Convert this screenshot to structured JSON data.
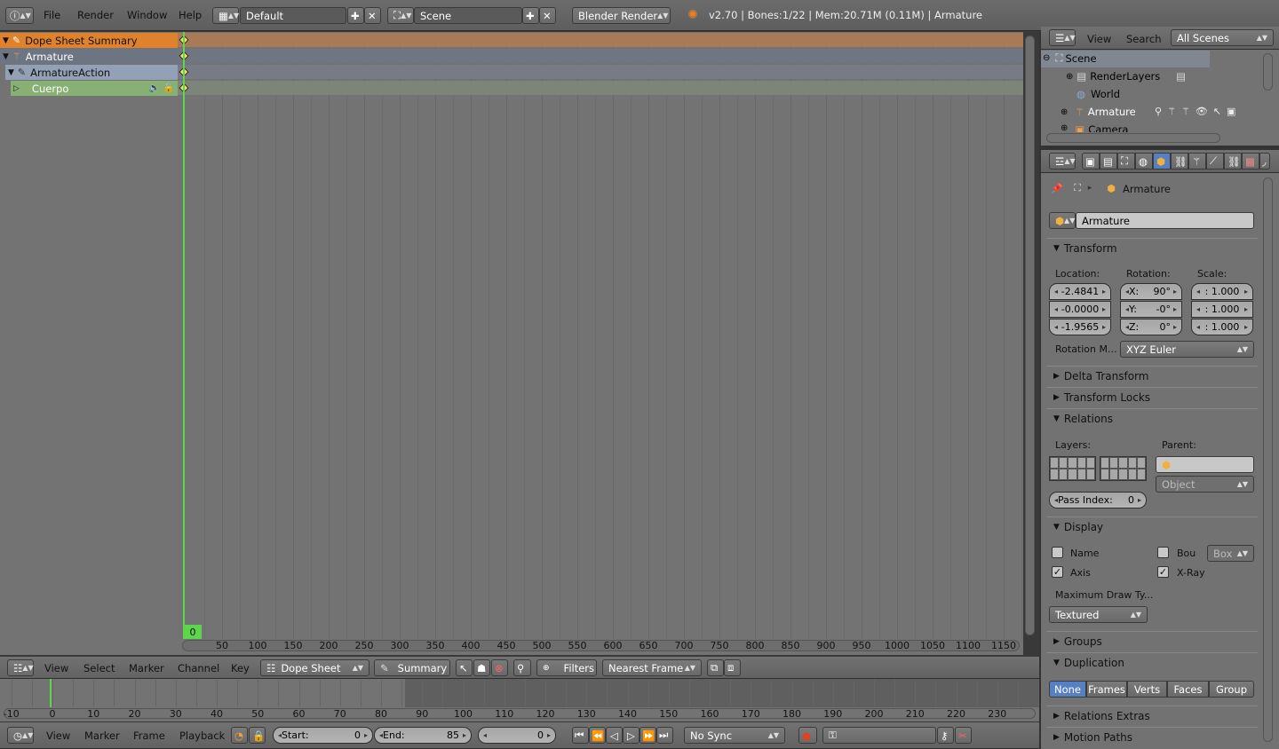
{
  "topbar": {
    "menus": [
      "File",
      "Render",
      "Window",
      "Help"
    ],
    "layout": "Default",
    "scene": "Scene",
    "engine": "Blender Render",
    "status": "v2.70 | Bones:1/22 | Mem:20.71M (0.11M) | Armature"
  },
  "dopesheet": {
    "channels": [
      {
        "label": "Dope Sheet Summary"
      },
      {
        "label": "Armature"
      },
      {
        "label": "ArmatureAction"
      },
      {
        "label": "Cuerpo"
      }
    ],
    "current_frame": "0",
    "ruler": [
      "50",
      "100",
      "150",
      "200",
      "250",
      "300",
      "350",
      "400",
      "450",
      "500",
      "550",
      "600",
      "650",
      "700",
      "750",
      "800",
      "850",
      "900",
      "950",
      "1000",
      "1050",
      "1100",
      "1150"
    ],
    "header": {
      "menus": [
        "View",
        "Select",
        "Marker",
        "Channel",
        "Key"
      ],
      "mode": "Dope Sheet",
      "summary": "Summary",
      "filters": "Filters",
      "snap": "Nearest Frame"
    }
  },
  "timeline": {
    "ruler": [
      "-10",
      "0",
      "10",
      "20",
      "30",
      "40",
      "50",
      "60",
      "70",
      "80",
      "90",
      "100",
      "110",
      "120",
      "130",
      "140",
      "150",
      "160",
      "170",
      "180",
      "190",
      "200",
      "210",
      "220",
      "230"
    ],
    "header": {
      "menus": [
        "View",
        "Marker",
        "Frame",
        "Playback"
      ],
      "start_label": "Start:",
      "start": "0",
      "end_label": "End:",
      "end": "85",
      "frame": "0",
      "sync": "No Sync"
    }
  },
  "outliner": {
    "menus": [
      "View",
      "Search"
    ],
    "filter": "All Scenes",
    "items": [
      {
        "label": "Scene"
      },
      {
        "label": "RenderLayers"
      },
      {
        "label": "World"
      },
      {
        "label": "Armature"
      },
      {
        "label": "Camera"
      }
    ]
  },
  "properties": {
    "breadcrumb": "Armature",
    "object_name": "Armature",
    "transform": {
      "title": "Transform",
      "location_label": "Location:",
      "rotation_label": "Rotation:",
      "scale_label": "Scale:",
      "location": [
        "-2.4841",
        "-0.0000",
        "-1.9565"
      ],
      "rotation_axes": [
        "X:",
        "Y:",
        "Z:"
      ],
      "rotation": [
        "90°",
        "-0°",
        "0°"
      ],
      "scale": [
        ": 1.000",
        ": 1.000",
        ": 1.000"
      ],
      "rotation_mode_label": "Rotation M...",
      "rotation_mode": "XYZ Euler"
    },
    "delta_transform": "Delta Transform",
    "transform_locks": "Transform Locks",
    "relations": {
      "title": "Relations",
      "layers_label": "Layers:",
      "parent_label": "Parent:",
      "parent_type": "Object",
      "pass_index_label": "Pass Index:",
      "pass_index": "0"
    },
    "display": {
      "title": "Display",
      "name": "Name",
      "bounds": "Bou",
      "bounds_type": "Box",
      "axis": "Axis",
      "xray": "X-Ray",
      "max_draw_label": "Maximum Draw Ty...",
      "max_draw": "Textured"
    },
    "groups": "Groups",
    "duplication": {
      "title": "Duplication",
      "options": [
        "None",
        "Frames",
        "Verts",
        "Faces",
        "Group"
      ]
    },
    "relations_extras": "Relations Extras",
    "motion_paths": "Motion Paths"
  },
  "colors": {
    "summary_row": "#e0822b",
    "playhead": "#5cd64c",
    "active_button": "#5680c2"
  }
}
